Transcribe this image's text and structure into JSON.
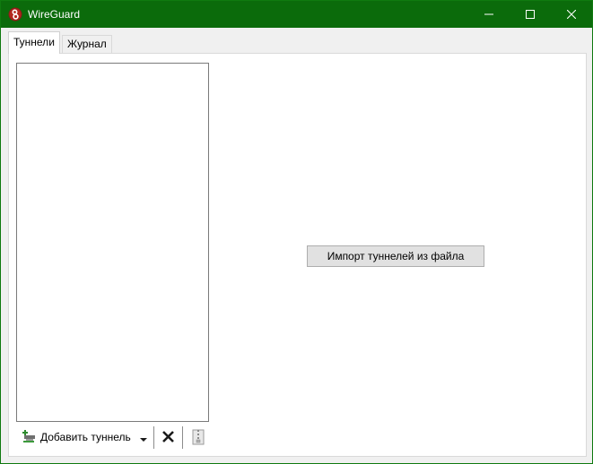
{
  "window": {
    "title": "WireGuard",
    "icon": "wireguard-logo-icon",
    "controls": [
      "minimize-icon",
      "maximize-icon",
      "close-icon"
    ],
    "accent_color": "#0b6b0b"
  },
  "tabs": [
    {
      "label": "Туннели",
      "active": true
    },
    {
      "label": "Журнал",
      "active": false
    }
  ],
  "tunnels": {
    "items": []
  },
  "toolbar": {
    "add_label": "Добавить туннель",
    "add_icon": "add-tunnel-icon",
    "dropdown_icon": "chevron-down-icon",
    "delete_icon": "delete-icon",
    "export_icon": "export-zip-icon"
  },
  "main": {
    "import_label": "Импорт туннелей из файла"
  }
}
